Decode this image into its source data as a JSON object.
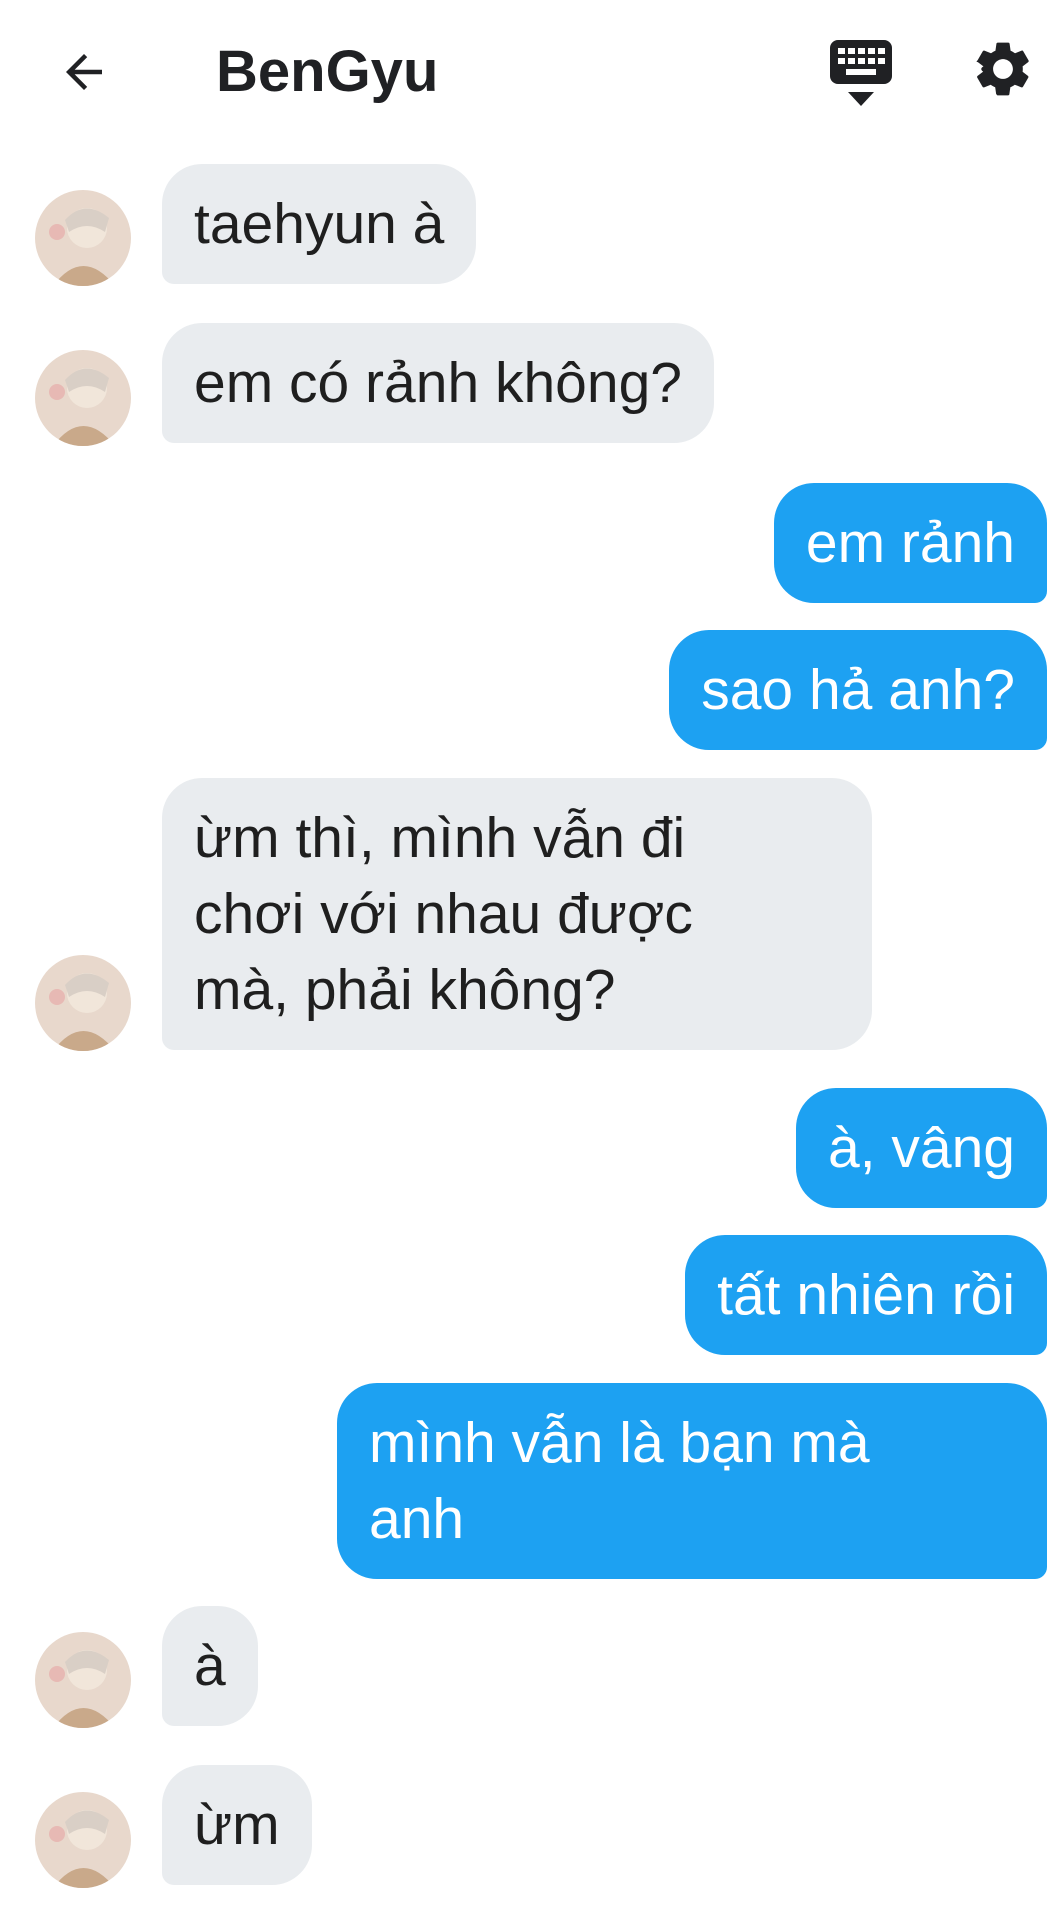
{
  "header": {
    "title": "BenGyu",
    "back_icon": "arrow-left-icon",
    "keyboard_icon": "keyboard-hide-icon",
    "settings_icon": "gear-icon"
  },
  "colors": {
    "incoming_bubble": "#e9ecef",
    "outgoing_bubble": "#1da1f2",
    "outgoing_text": "#ffffff",
    "incoming_text": "#1f1f1f"
  },
  "messages": [
    {
      "from": "them",
      "text": "taehyun à"
    },
    {
      "from": "them",
      "text": "em có rảnh không?"
    },
    {
      "from": "me",
      "text": "em rảnh"
    },
    {
      "from": "me",
      "text": "sao hả anh?"
    },
    {
      "from": "them",
      "text": "ừm thì, mình vẫn đi\nchơi với nhau được\nmà, phải không?"
    },
    {
      "from": "me",
      "text": "à, vâng"
    },
    {
      "from": "me",
      "text": "tất nhiên rồi"
    },
    {
      "from": "me",
      "text": "mình vẫn là bạn mà\nanh"
    },
    {
      "from": "them",
      "text": "à"
    },
    {
      "from": "them",
      "text": "ừm"
    }
  ]
}
